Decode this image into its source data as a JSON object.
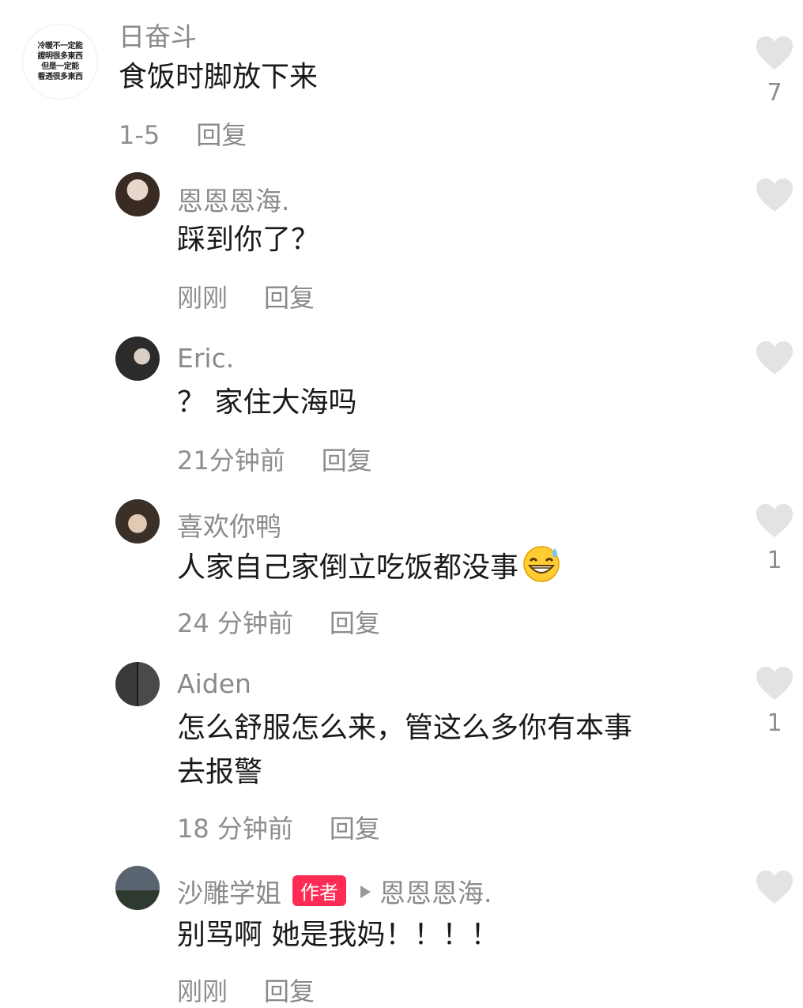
{
  "comments": [
    {
      "avatar_text": [
        "冷暖不一定能",
        "證明很多東西",
        "但是一定能",
        "看透很多東西"
      ],
      "username": "日奋斗",
      "content": "食饭时脚放下来",
      "time": "1-5",
      "reply": "回复",
      "likes": "7"
    },
    {
      "username": "恩恩恩海.",
      "content": "踩到你了？",
      "time": "刚刚",
      "reply": "回复",
      "likes": ""
    },
    {
      "username": "Eric.",
      "content": "？ 家住大海吗",
      "time": "21分钟前",
      "reply": "回复",
      "likes": ""
    },
    {
      "username": "喜欢你鸭",
      "content": "人家自己家倒立吃饭都没事",
      "emoji": "grinning-sweat-emoji",
      "time": "24 分钟前",
      "reply": "回复",
      "likes": "1"
    },
    {
      "username": "Aiden",
      "content_lines": [
        "怎么舒服怎么来，管这么多你有本事",
        "去报警"
      ],
      "time": "18 分钟前",
      "reply": "回复",
      "likes": "1"
    },
    {
      "username": "沙雕学姐",
      "badge": "作者",
      "reply_to": "恩恩恩海.",
      "content": "别骂啊 她是我妈！！！！",
      "time": "刚刚",
      "reply": "回复",
      "likes": ""
    }
  ],
  "colors": {
    "badge": "#fe2c55",
    "heart": "#e3e3e3",
    "muted_text": "#8a8a8a"
  }
}
